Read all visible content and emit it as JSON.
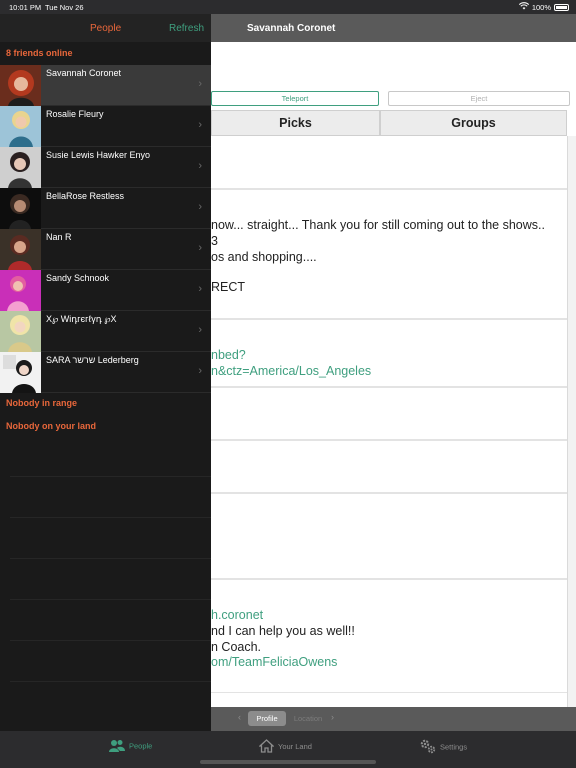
{
  "status": {
    "time": "10:01 PM",
    "date": "Tue Nov 26",
    "battery": "100%"
  },
  "sidebar": {
    "title": "People",
    "refresh_label": "Refresh",
    "friends_online_label": "8 friends online",
    "friends": [
      {
        "name": "Savannah Coronet",
        "selected": true
      },
      {
        "name": "Rosalie Fleury"
      },
      {
        "name": "Susie Lewis Hawker Enyo"
      },
      {
        "name": "BellaRose Restless"
      },
      {
        "name": "Nan R"
      },
      {
        "name": "Sandy Schnook"
      },
      {
        "name": "X℘ Wiդгєгℓγդ ℘X"
      },
      {
        "name": "SARA שרשר Lederberg"
      }
    ],
    "nobody_in_range": "Nobody in range",
    "nobody_on_land": "Nobody on your land"
  },
  "detail": {
    "nav_title": "Savannah Coronet",
    "teleport_label": "Teleport",
    "eject_label": "Eject",
    "tabs": [
      "Picks",
      "Groups"
    ],
    "text_lines": [
      "now... straight... Thank you for still coming out to the shows..",
      "3",
      "os and shopping....",
      "RECT"
    ],
    "link_lines": [
      "nbed?",
      "n&ctz=America/Los_Angeles"
    ],
    "bottom_lines": [
      {
        "text": "h.coronet",
        "link": true
      },
      {
        "text": "nd I can help you as well!!",
        "link": false
      },
      {
        "text": "n Coach.",
        "link": false
      },
      {
        "text": "om/TeamFeliciaOwens",
        "link": true
      }
    ],
    "bottom_tabs": {
      "active": "Profile",
      "inactive": "Location"
    }
  },
  "tabbar": {
    "items": [
      {
        "label": "People",
        "icon": "people-icon",
        "active": true
      },
      {
        "label": "Your Land",
        "icon": "home-icon"
      },
      {
        "label": "Settings",
        "icon": "gears-icon"
      }
    ]
  },
  "colors": {
    "accent_orange": "#e8673b",
    "accent_green": "#3f9f7f"
  }
}
